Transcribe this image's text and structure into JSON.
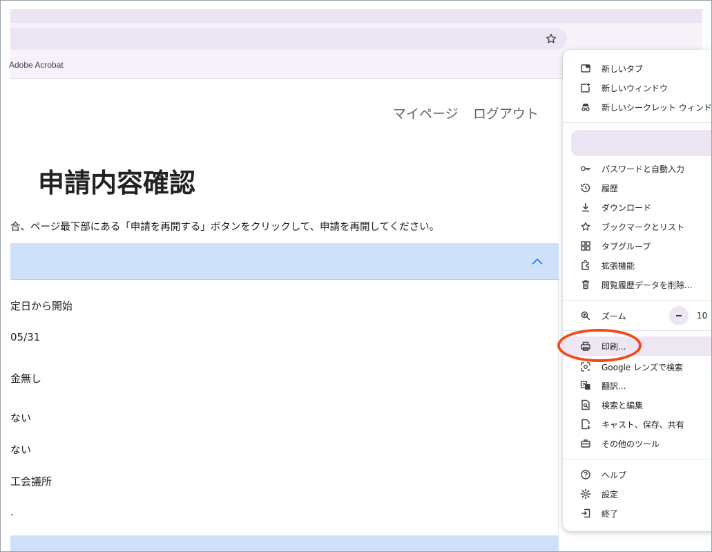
{
  "browser": {
    "bookmarks_bar": {
      "items": [
        "Adobe Acrobat"
      ]
    },
    "star_icon": "star-outline-icon"
  },
  "page": {
    "nav": {
      "mypage": "マイページ",
      "logout": "ログアウト"
    },
    "title": "申請内容確認",
    "instruction": "合、ページ最下部にある「申請を再開する」ボタンをクリックして、申請を再開してください。",
    "accordion": {
      "expanded": true,
      "rows": [
        "定日から開始",
        "05/31",
        "金無し",
        "ない",
        "ない",
        "工会議所",
        "."
      ]
    }
  },
  "menu": {
    "sections": [
      [
        {
          "label": "新しいタブ",
          "icon": "new-tab-icon"
        },
        {
          "label": "新しいウィンドウ",
          "icon": "new-window-icon"
        },
        {
          "label": "新しいシークレット ウィンドウ",
          "icon": "incognito-icon"
        }
      ],
      [
        {
          "label": "パスワードと自動入力",
          "icon": "key-icon"
        },
        {
          "label": "履歴",
          "icon": "history-icon"
        },
        {
          "label": "ダウンロード",
          "icon": "download-icon"
        },
        {
          "label": "ブックマークとリスト",
          "icon": "star-icon"
        },
        {
          "label": "タブグループ",
          "icon": "tab-groups-icon"
        },
        {
          "label": "拡張機能",
          "icon": "extension-icon"
        },
        {
          "label": "閲覧履歴データを削除...",
          "icon": "trash-icon"
        }
      ],
      [
        {
          "label": "ズーム",
          "icon": "zoom-icon",
          "zoom_value": "10"
        }
      ],
      [
        {
          "label": "印刷...",
          "icon": "print-icon",
          "highlighted": true
        },
        {
          "label": "Google レンズで検索",
          "icon": "lens-icon"
        },
        {
          "label": "翻訳...",
          "icon": "translate-icon"
        },
        {
          "label": "検索と編集",
          "icon": "find-icon"
        },
        {
          "label": "キャスト、保存、共有",
          "icon": "cast-save-icon"
        },
        {
          "label": "その他のツール",
          "icon": "toolbox-icon"
        }
      ],
      [
        {
          "label": "ヘルプ",
          "icon": "help-icon"
        },
        {
          "label": "設定",
          "icon": "settings-icon"
        },
        {
          "label": "終了",
          "icon": "exit-icon"
        }
      ]
    ]
  },
  "colors": {
    "accordion_bg": "#cfe0fb",
    "menu_hover": "#ede6f3",
    "annotation": "#f2491d",
    "chrome_bg": "#f7f2fa"
  }
}
